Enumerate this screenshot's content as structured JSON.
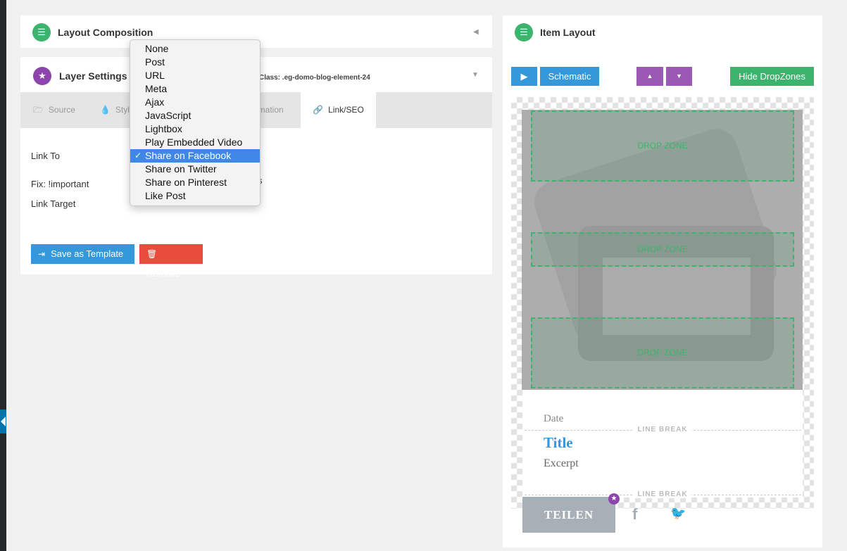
{
  "layout_composition": {
    "title": "Layout Composition"
  },
  "layer_settings": {
    "title": "Layer Settings",
    "class_label": "Class: .eg-domo-blog-element-24",
    "tabs": [
      {
        "label": "Source",
        "icon": "folder-icon"
      },
      {
        "label": "Style",
        "icon": "drop-icon"
      },
      {
        "label": "imation",
        "icon": ""
      },
      {
        "label": "Link/SEO",
        "icon": "link-icon"
      }
    ],
    "fields": {
      "link_to": "Link To",
      "fix_important": "Fix: !important",
      "fix_suffix": "s",
      "link_target": "Link Target"
    },
    "buttons": {
      "save_template": "Save as Template",
      "remove": "Remove"
    }
  },
  "dropdown": {
    "options": [
      "None",
      "Post",
      "URL",
      "Meta",
      "Ajax",
      "JavaScript",
      "Lightbox",
      "Play Embedded Video",
      "Share on Facebook",
      "Share on Twitter",
      "Share on Pinterest",
      "Like Post"
    ],
    "selected": "Share on Facebook"
  },
  "item_layout": {
    "title": "Item Layout",
    "schematic": "Schematic",
    "hide_dropzones": "Hide DropZones",
    "drop_zone_label": "DROP ZONE",
    "line_break": "LINE BREAK",
    "date": "Date",
    "post_title": "Title",
    "excerpt": "Excerpt",
    "share_label": "TEILEN",
    "social": {
      "facebook": "f",
      "twitter": "🐦"
    }
  },
  "colors": {
    "green": "#3cb46e",
    "purple": "#8e44ad",
    "blue": "#3498db",
    "red": "#e74c3c",
    "selection": "#3f88e7"
  }
}
